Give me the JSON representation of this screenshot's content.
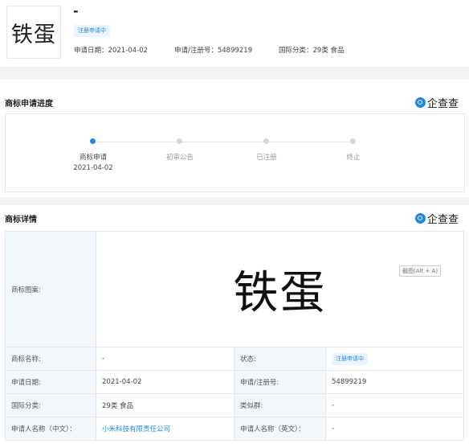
{
  "header": {
    "logo_text": "铁蛋",
    "title": "-",
    "status_badge": "注册申请中",
    "apply_date": "申请日期：2021-04-02",
    "reg_no": "申请/注册号：54899219",
    "intl_class": "国际分类：29类 食品"
  },
  "brand": {
    "name": "企查查",
    "icon": "qichacha-logo-icon",
    "color": "#1e88e5"
  },
  "progress": {
    "title": "商标申请进度",
    "steps": [
      {
        "label": "商标申请",
        "date": "2021-04-02",
        "active": true
      },
      {
        "label": "初审公告",
        "active": false
      },
      {
        "label": "已注册",
        "active": false
      },
      {
        "label": "终止",
        "active": false
      }
    ]
  },
  "details": {
    "title": "商标详情",
    "image_label": "商标图案:",
    "image_text": "铁蛋",
    "image_tooltip": "截图(Alt + A)",
    "rows": [
      {
        "l1": "商标名称:",
        "v1": "-",
        "l2": "状态:",
        "v2": "注册申请中"
      },
      {
        "l1": "申请日期:",
        "v1": "2021-04-02",
        "l2": "申请/注册号:",
        "v2": "54899219"
      },
      {
        "l1": "国际分类:",
        "v1": "29类 食品",
        "l2": "类似群:",
        "v2": "-"
      },
      {
        "l1": "申请人名称（中文）：",
        "v1": "小米科技有限责任公司",
        "l2": "申请人名称（英文）：",
        "v2": "-"
      }
    ]
  }
}
